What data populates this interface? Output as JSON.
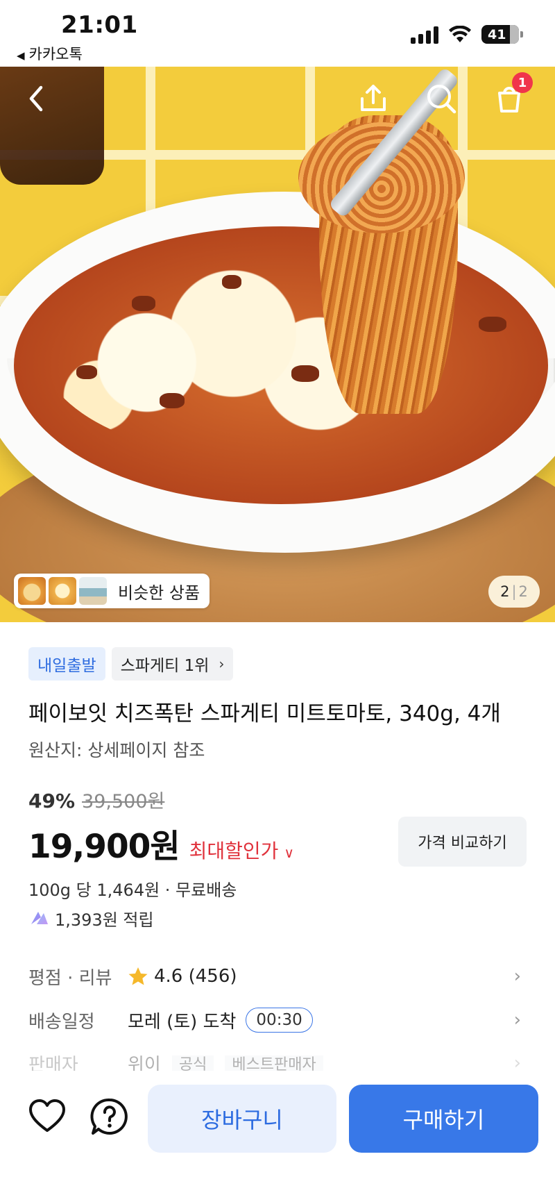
{
  "status_bar": {
    "time": "21:01",
    "back_app": "카카오톡",
    "battery": "41"
  },
  "hero": {
    "cart_badge": "1",
    "similar_label": "비슷한 상품",
    "page_current": "2",
    "page_total": "2",
    "icons": [
      "back-icon",
      "share-icon",
      "search-icon",
      "cart-icon"
    ]
  },
  "tags": {
    "delivery": "내일출발",
    "rank": "스파게티 1위"
  },
  "product": {
    "title": "페이보잇 치즈폭탄 스파게티 미트토마토, 340g, 4개",
    "origin": "원산지: 상세페이지 참조",
    "discount_percent": "49%",
    "original_price": "39,500원",
    "price": "19,900원",
    "max_discount_label": "최대할인가",
    "compare_label": "가격 비교하기",
    "unit_price": "100g 당 1,464원 · 무료배송",
    "points": "1,393원 적립"
  },
  "info": {
    "rating_label": "평점 · 리뷰",
    "rating_value": "4.6 (456)",
    "rating": 4.6,
    "shipping_label": "배송일정",
    "shipping_value": "모레 (토) 도착",
    "shipping_time": "00:30",
    "seller_label": "판매자",
    "seller_value": "위이",
    "seller_badge_1": "공식",
    "seller_badge_2": "베스트판매자"
  },
  "bottom": {
    "cart_label": "장바구니",
    "buy_label": "구매하기"
  },
  "colors": {
    "accent_blue": "#3878e8",
    "discount_red": "#e0323c",
    "badge_red": "#f0354b"
  }
}
